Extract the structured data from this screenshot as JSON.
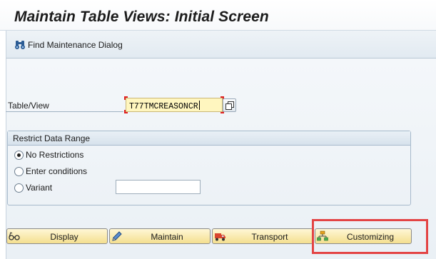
{
  "title": "Maintain Table Views: Initial Screen",
  "toolbar": {
    "find_dialog_label": "Find Maintenance Dialog"
  },
  "table_view": {
    "label": "Table/View",
    "value": "T77TMCREASONCR"
  },
  "restrict": {
    "title": "Restrict Data Range",
    "options": [
      {
        "label": "No Restrictions",
        "selected": true
      },
      {
        "label": "Enter conditions",
        "selected": false
      },
      {
        "label": "Variant",
        "selected": false
      }
    ],
    "variant_value": ""
  },
  "actions": {
    "display": "Display",
    "maintain": "Maintain",
    "transport": "Transport",
    "customizing": "Customizing"
  },
  "colors": {
    "highlight": "#e34444",
    "input_focus_bg": "#fff6bf",
    "action_button": "#f4df8f"
  }
}
